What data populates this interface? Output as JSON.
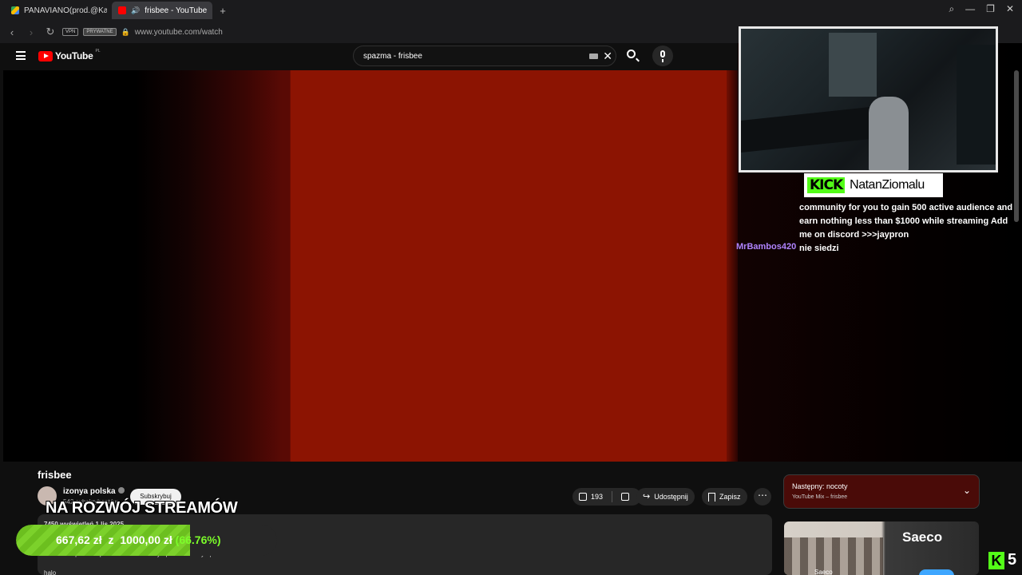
{
  "browser": {
    "tabs": [
      {
        "label": "PANAVIANO(prod.@Kamp",
        "active": false
      },
      {
        "label": "frisbee - YouTube",
        "active": true
      }
    ],
    "new_tab": "+",
    "vpn_badge": "VPN",
    "private_badge": "PRYWATNE",
    "url": "www.youtube.com/watch"
  },
  "youtube": {
    "logo_text": "YouTube",
    "country_code": "PL",
    "search_query": "spazma - frisbee"
  },
  "stream_overlay": {
    "kick_logo": "KICK",
    "streamer_name": "NatanZiomalu",
    "chat": [
      {
        "user": "",
        "text_lines": [
          "community for you to gain 500 active audience and",
          "earn nothing less than $1000 while streaming Add",
          "me on discord >>>jaypron"
        ]
      },
      {
        "user": "MrBambos420",
        "text_lines": [
          "nie siedzi"
        ]
      }
    ],
    "headline": "NA ROZWÓJ STREAMÓW",
    "goal": {
      "current": "667,62 zł",
      "sep": "z",
      "target": "1000,00 zł",
      "percent_label": "(66.76%)",
      "fraction": 0.6676
    },
    "kick_viewers_logo": "K",
    "kick_viewers": "5"
  },
  "video": {
    "title": "frisbee",
    "channel": "izonya polska",
    "subscribers": "542 subskrybentów",
    "subscribe_label": "Subskrybuj",
    "likes": "193",
    "share_label": "Udostępnij",
    "save_label": "Zapisz",
    "more_label": "⋯",
    "description_meta": "7450 wyświetleń  1 lis 2025",
    "description_tags": "#frisbee  #spazma  #polska  #music  #izonya polska  #izonya polska",
    "description_text": "halo"
  },
  "sidebar": {
    "next_up_title": "Następny: nocoty",
    "next_up_sub": "YouTube Mix – frisbee",
    "ad_brand": "Saeco",
    "ad_channel": "Saeco"
  },
  "colors": {
    "video_red": "#8c1402",
    "kick_green": "#53fc18",
    "chat_user": "#b084ff",
    "goal_fill": "#7cd12b"
  }
}
